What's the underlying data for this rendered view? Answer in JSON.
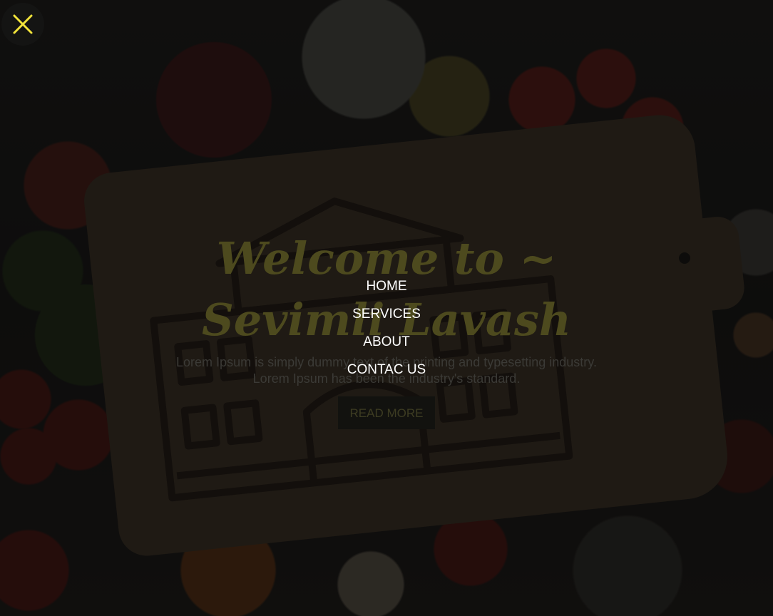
{
  "hero": {
    "title_line1": "Welcome to ~",
    "title_line2": "Sevimli Lavash",
    "description_line1": "Lorem Ipsum is simply dummy text of the printing and typesetting industry.",
    "description_line2": "Lorem Ipsum has been the industry's standard.",
    "button_label": "READ MORE"
  },
  "menu": {
    "items": [
      {
        "label": "HOME"
      },
      {
        "label": "SERVICES"
      },
      {
        "label": "ABOUT"
      },
      {
        "label": "CONTAC US"
      }
    ]
  },
  "close_button": {
    "icon": "close-icon"
  },
  "colors": {
    "accent_yellow": "#f2e33a",
    "menu_text": "#ffffff",
    "overlay": "#0a0a09"
  }
}
